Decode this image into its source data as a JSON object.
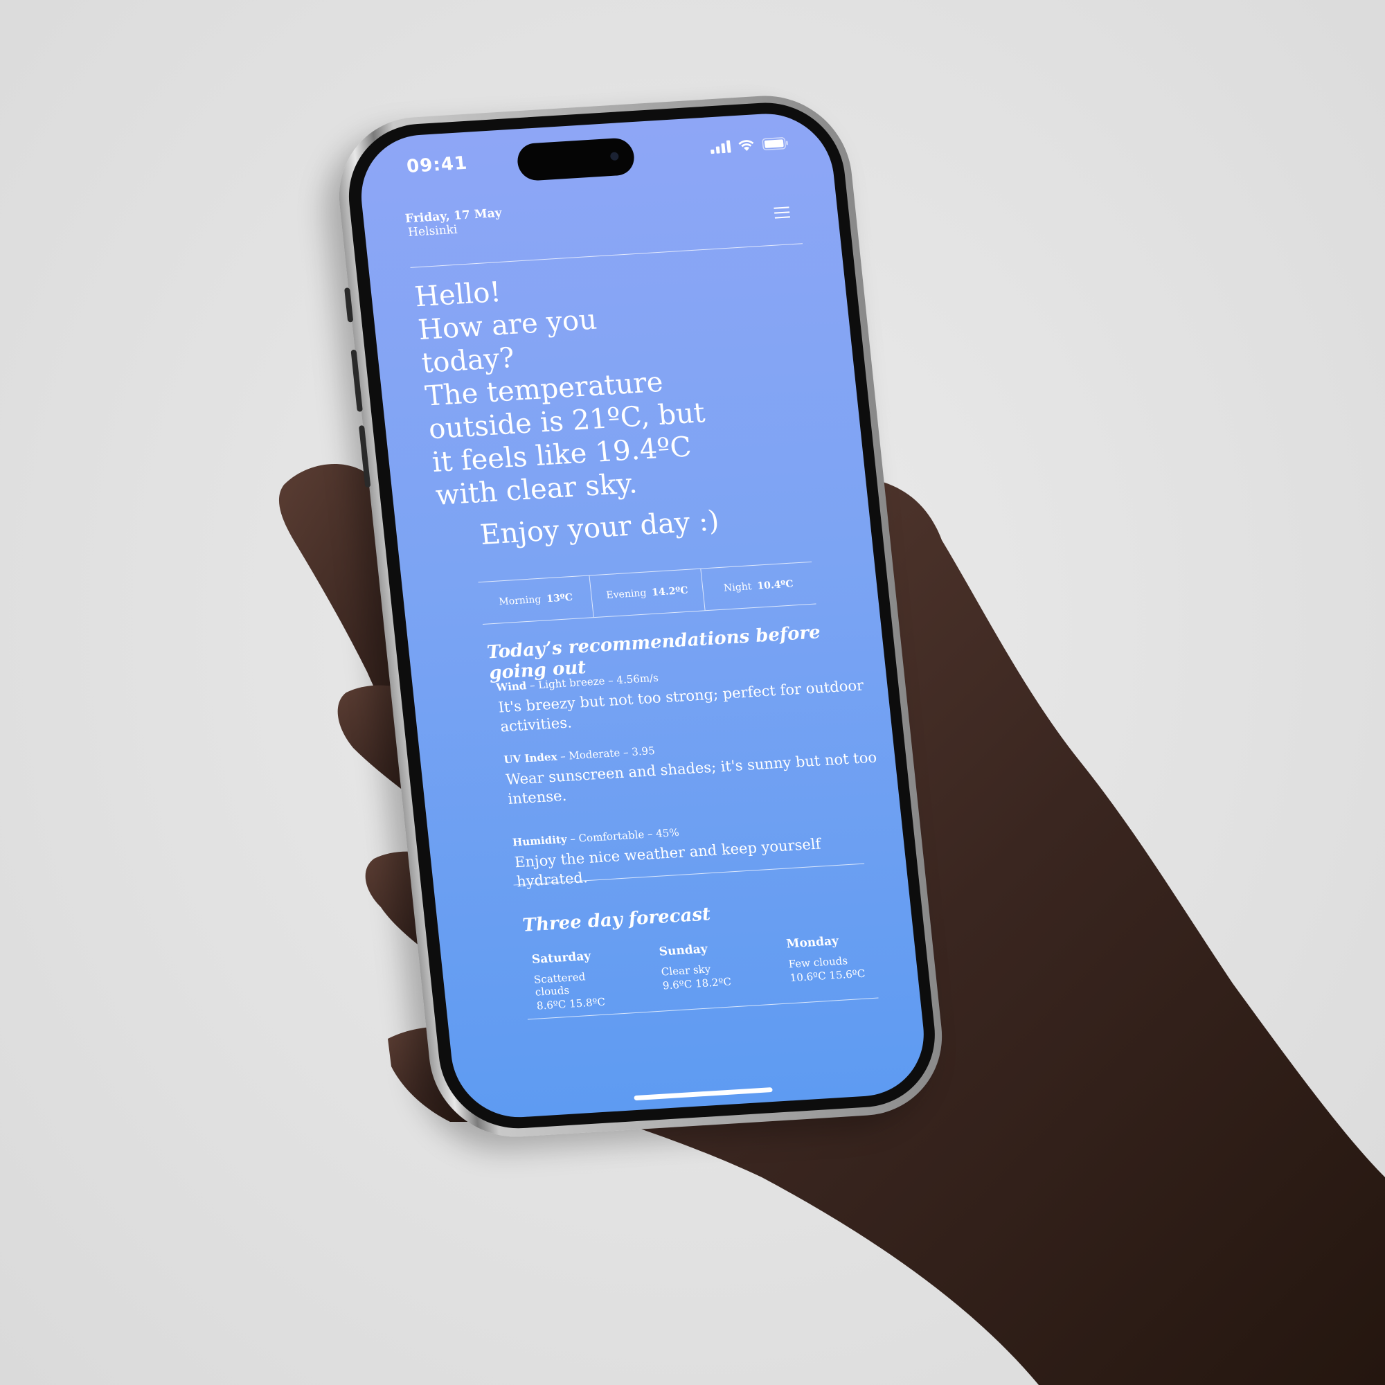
{
  "status_bar": {
    "time": "09:41"
  },
  "header": {
    "date": "Friday, 17 May",
    "city": "Helsinki"
  },
  "greeting": {
    "line1": "Hello!",
    "line2": "How are you today?",
    "line3": "The temperature outside is 21ºC, but it feels like 19.4ºC with clear sky.",
    "enjoy": "Enjoy your day :)"
  },
  "periods": [
    {
      "label": "Morning",
      "value": "13ºC"
    },
    {
      "label": "Evening",
      "value": "14.2ºC"
    },
    {
      "label": "Night",
      "value": "10.4ºC"
    }
  ],
  "recommendations": {
    "title": "Today’s recommendations before going out",
    "items": [
      {
        "key": "Wind",
        "detail": "– Light breeze – 4.56m/s",
        "text": "It's breezy but not too strong; perfect for outdoor activities."
      },
      {
        "key": "UV Index",
        "detail": "– Moderate – 3.95",
        "text": "Wear sunscreen and shades; it's sunny but not too intense."
      },
      {
        "key": "Humidity",
        "detail": "– Comfortable – 45%",
        "text": "Enjoy the nice weather and keep yourself hydrated."
      }
    ]
  },
  "forecast": {
    "title": "Three day forecast",
    "days": [
      {
        "name": "Saturday",
        "desc": "Scattered clouds",
        "temps": "8.6ºC  15.8ºC"
      },
      {
        "name": "Sunday",
        "desc": "Clear sky",
        "temps": "9.6ºC  18.2ºC"
      },
      {
        "name": "Monday",
        "desc": "Few clouds",
        "temps": "10.6ºC  15.6ºC"
      }
    ]
  },
  "icons": {
    "menu": "hamburger-menu-icon",
    "signal": "cellular-signal-icon",
    "wifi": "wifi-icon",
    "battery": "battery-icon"
  },
  "colors": {
    "screen_top": "#8ea6f6",
    "screen_bottom": "#5e9bf2",
    "text": "#ffffff",
    "background": "#e3e3e3"
  }
}
